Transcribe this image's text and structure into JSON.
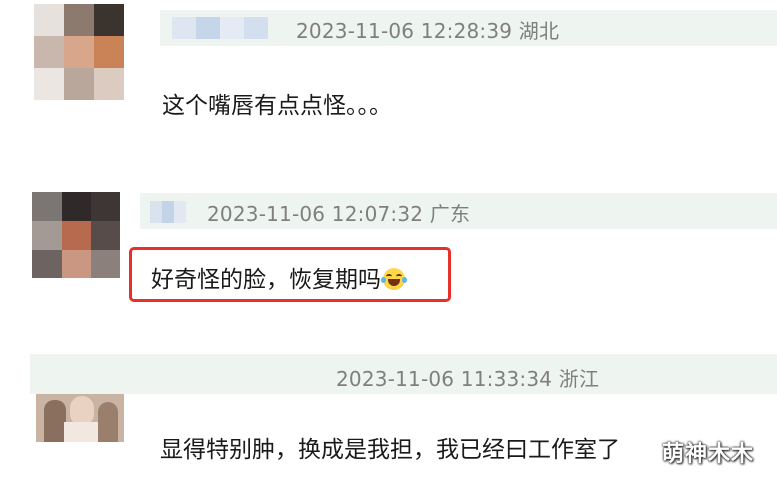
{
  "comments": [
    {
      "timestamp": "2023-11-06 12:28:39",
      "location": "湖北",
      "text": "这个嘴唇有点点怪。。。"
    },
    {
      "timestamp": "2023-11-06 12:07:32",
      "location": "广东",
      "text": "好奇怪的脸，恢复期吗",
      "emoji": "laughing-tears-emoji",
      "highlighted": true
    },
    {
      "timestamp": "2023-11-06 11:33:34",
      "location": "浙江",
      "text": "显得特别肿，换成是我担，我已经曰工作室了"
    }
  ],
  "watermark": "萌神木木",
  "colors": {
    "band": "#eef4ef",
    "highlight": "#e8302a",
    "meta_text": "#7f7f7f"
  }
}
